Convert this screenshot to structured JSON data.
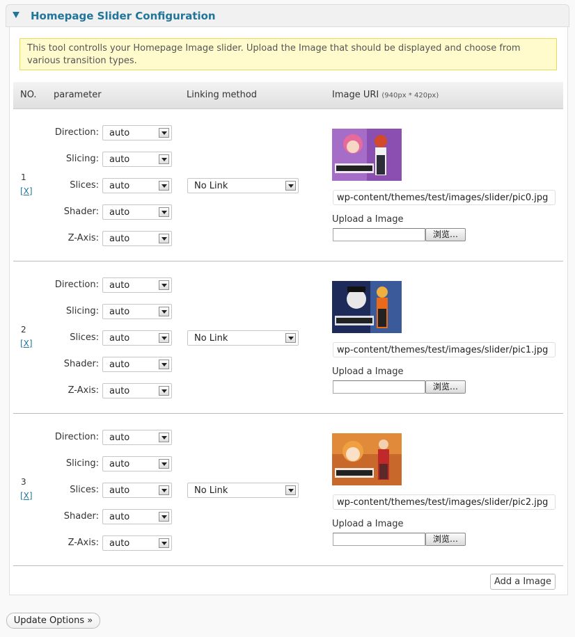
{
  "panel": {
    "title": "Homepage Slider Configuration"
  },
  "notice": "This tool controlls your Homepage Image slider. Upload the Image that should be displayed and choose from various transition types.",
  "table": {
    "headers": {
      "no": "NO.",
      "parameter": "parameter",
      "linking": "Linking method",
      "image": "Image URI",
      "image_hint": "(940px * 420px)"
    }
  },
  "labels": {
    "direction": "Direction:",
    "slicing": "Slicing:",
    "slices": "Slices:",
    "shader": "Shader:",
    "zaxis": "Z-Axis:",
    "upload": "Upload a Image",
    "browse": "浏览…",
    "delete": "[X]"
  },
  "rows": [
    {
      "no": "1",
      "direction": "auto",
      "slicing": "auto",
      "slices": "auto",
      "shader": "auto",
      "zaxis": "auto",
      "link": "No Link",
      "uri": "wp-content/themes/test/images/slider/pic0.jpg"
    },
    {
      "no": "2",
      "direction": "auto",
      "slicing": "auto",
      "slices": "auto",
      "shader": "auto",
      "zaxis": "auto",
      "link": "No Link",
      "uri": "wp-content/themes/test/images/slider/pic1.jpg"
    },
    {
      "no": "3",
      "direction": "auto",
      "slicing": "auto",
      "slices": "auto",
      "shader": "auto",
      "zaxis": "auto",
      "link": "No Link",
      "uri": "wp-content/themes/test/images/slider/pic2.jpg"
    }
  ],
  "buttons": {
    "add_image": "Add a Image",
    "update": "Update Options »"
  },
  "colors": {
    "accent": "#21759b",
    "notice_bg": "#fffbcc",
    "notice_border": "#e6db55"
  }
}
